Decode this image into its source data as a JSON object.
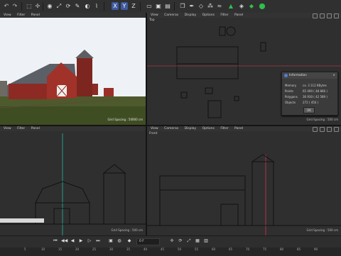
{
  "menus": {
    "top_left": [
      "View",
      "Filter",
      "Panel"
    ],
    "top_right": [
      "View",
      "Cameras",
      "Display",
      "Options",
      "Filter",
      "Panel"
    ],
    "bottom_left": [
      "View",
      "Filter",
      "Panel"
    ],
    "bottom_right": [
      "View",
      "Cameras",
      "Display",
      "Options",
      "Filter",
      "Panel"
    ]
  },
  "viewports": {
    "top_left_grid": "Grid Spacing : 50000 cm",
    "top_right_title": "Top",
    "top_right_grid": "Grid Spacing : 500 cm",
    "bottom_left_grid": "Grid Spacing : 500 cm",
    "bottom_right_title": "Front",
    "bottom_right_grid": "Grid Spacing : 500 cm"
  },
  "info": {
    "title": "Information",
    "close": "×",
    "rows": [
      {
        "label": "Memory",
        "value": "ca. 3 112 KBytes"
      },
      {
        "label": "Points",
        "value": "65 490 ( 48 866 )"
      },
      {
        "label": "Polygons",
        "value": "36 930 ( 42 589 )"
      },
      {
        "label": "Objects",
        "value": "272 ( 456 )"
      }
    ],
    "ok": "OK"
  },
  "timeline": {
    "frame": "0 F",
    "ticks": [
      "0",
      "5",
      "10",
      "15",
      "20",
      "25",
      "30",
      "35",
      "40",
      "45",
      "50",
      "55",
      "60",
      "65",
      "70",
      "75",
      "80",
      "85",
      "90"
    ]
  },
  "colors": {
    "accent": "#4f7ed1",
    "green": "#2fbf4a",
    "y_axis": "#20c6b5",
    "x_axis": "#e03a52"
  }
}
